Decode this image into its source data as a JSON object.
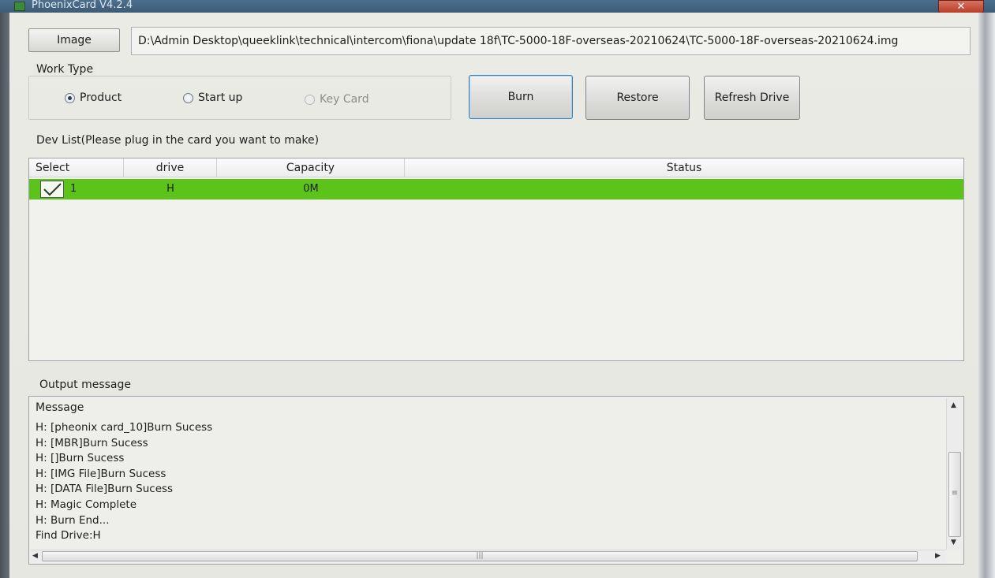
{
  "window": {
    "title": "PhoenixCard V4.2.4",
    "close_label": "✕"
  },
  "image": {
    "button_label": "Image",
    "path": "D:\\Admin Desktop\\queeklink\\technical\\intercom\\fiona\\update 18f\\TC-5000-18F-overseas-20210624\\TC-5000-18F-overseas-20210624.img"
  },
  "work_type": {
    "legend": "Work Type",
    "options": [
      {
        "label": "Product",
        "selected": true,
        "enabled": true
      },
      {
        "label": "Start up",
        "selected": false,
        "enabled": true
      },
      {
        "label": "Key Card",
        "selected": false,
        "enabled": false
      }
    ]
  },
  "actions": {
    "burn": "Burn",
    "restore": "Restore",
    "refresh": "Refresh Drive"
  },
  "dev_list": {
    "legend": "Dev List(Please plug in the card you want to make)",
    "columns": [
      "Select",
      "drive",
      "Capacity",
      "Status"
    ],
    "rows": [
      {
        "select": "1",
        "checked": true,
        "drive": "H",
        "capacity": "0M",
        "status": "",
        "row_color": "#5cc31a"
      }
    ]
  },
  "output": {
    "legend": "Output message",
    "header": "Message",
    "lines": [
      "H: [pheonix card_10]Burn Sucess",
      "H: [MBR]Burn Sucess",
      "H: []Burn Sucess",
      "H: [IMG File]Burn Sucess",
      "H: [DATA File]Burn Sucess",
      "H: Magic Complete",
      "H: Burn End...",
      "Find Drive:H"
    ]
  },
  "colors": {
    "accent_row": "#5cc31a",
    "default_button_border": "#3c7fb1"
  }
}
